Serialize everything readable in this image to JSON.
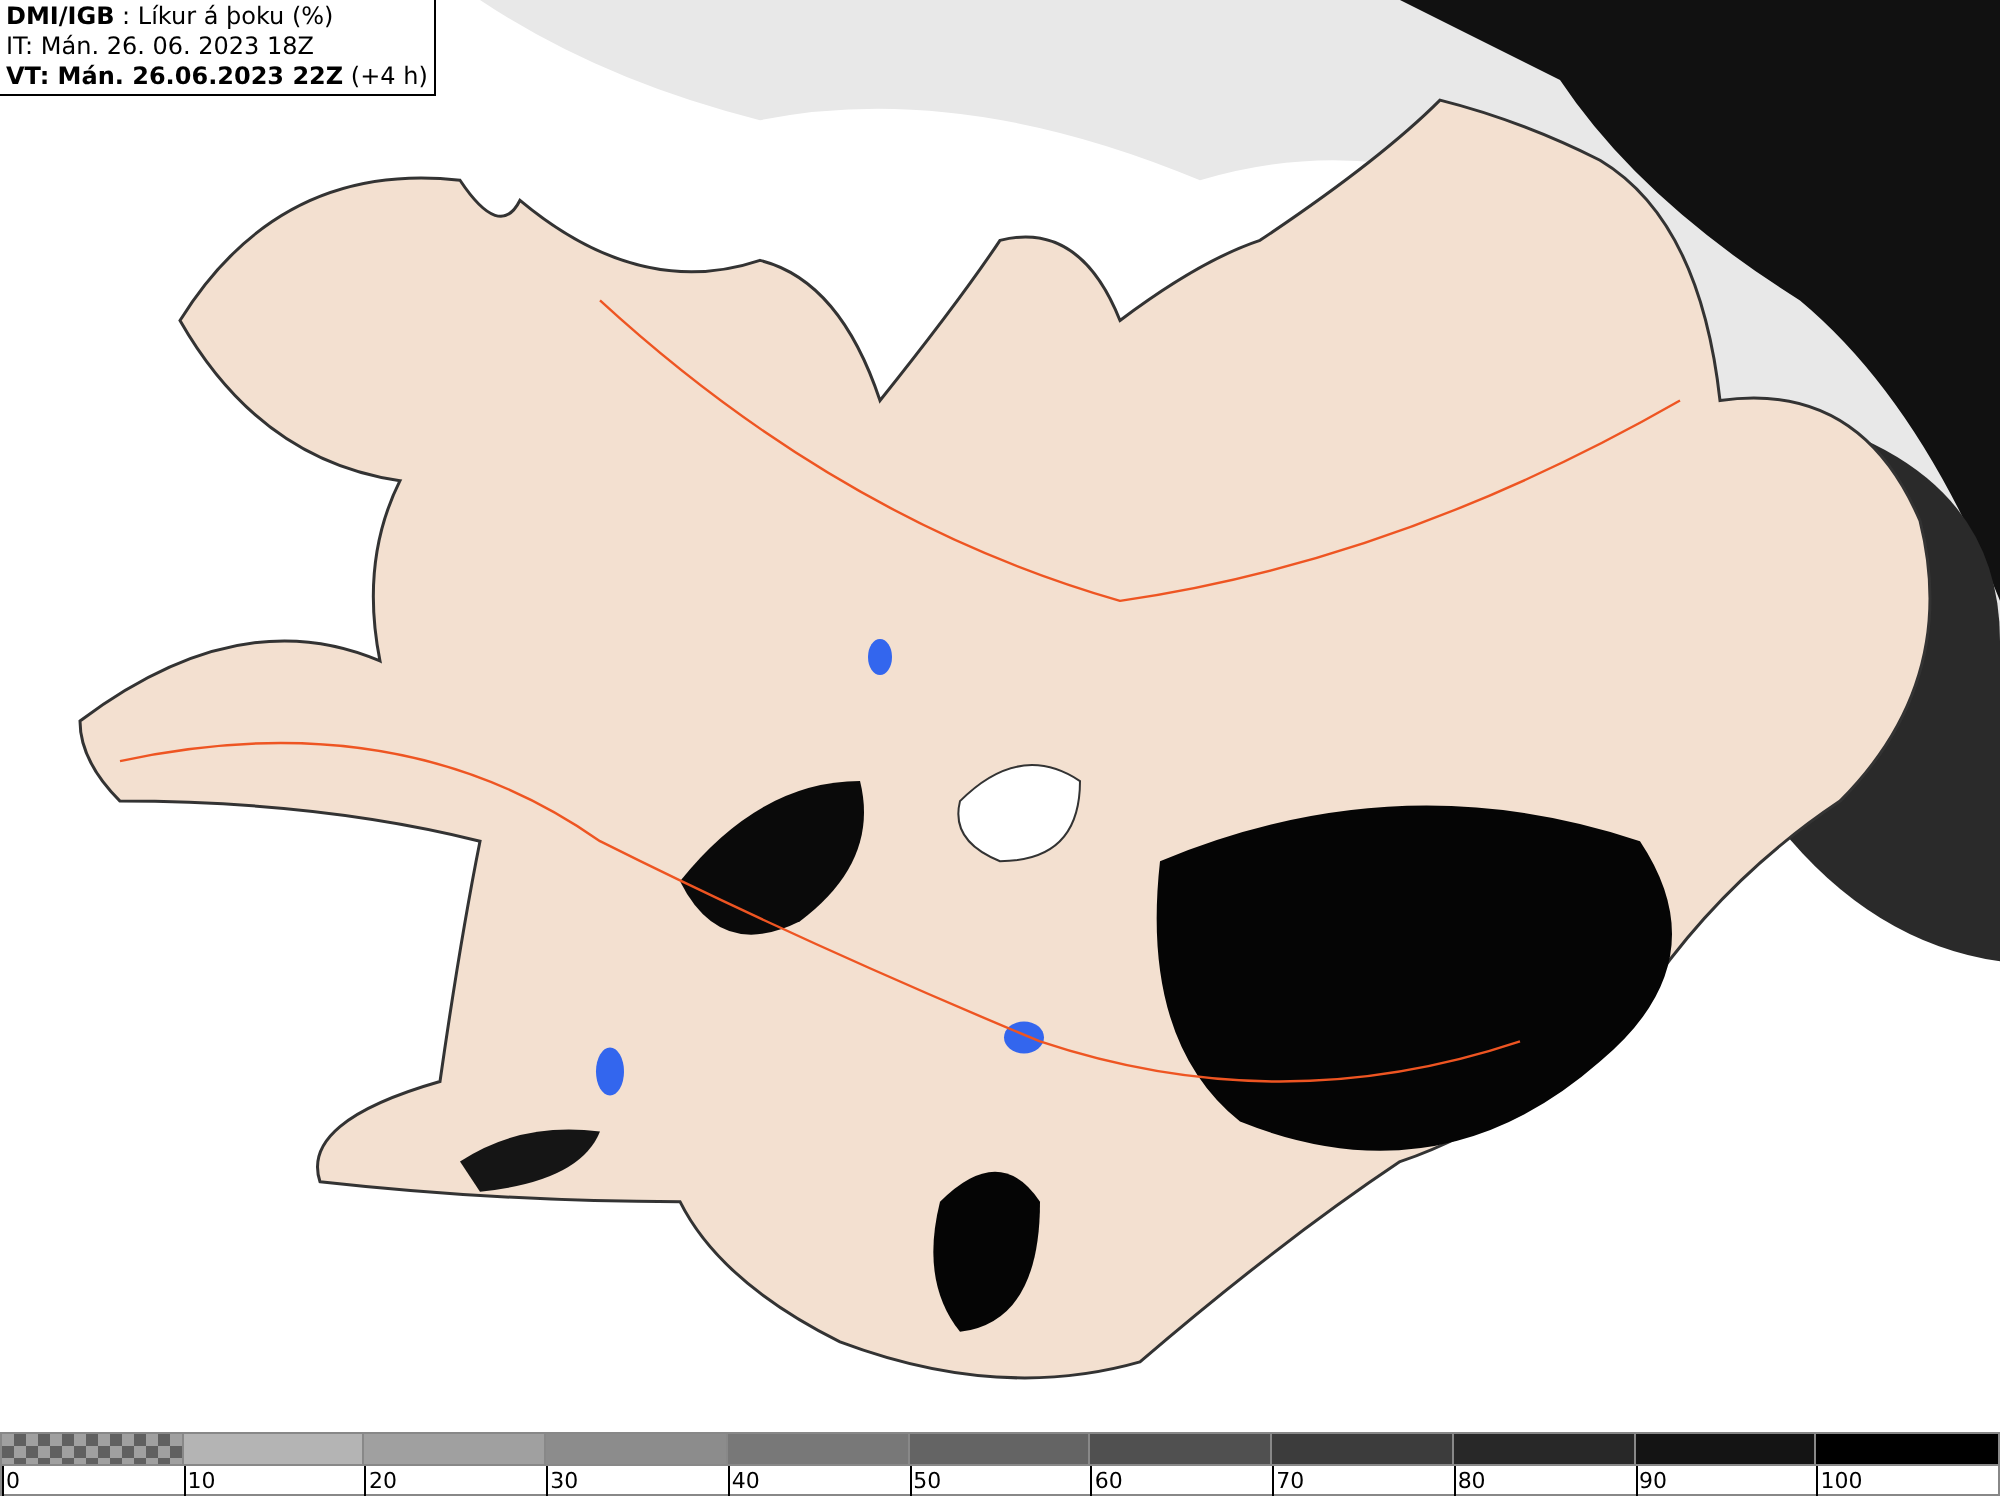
{
  "header": {
    "lines": [
      "**DMI/IGB** : Líkur á þoku (%)",
      "IT: Mán. 26. 06. 2023 18Z",
      "**VT: Mán. 26.06.2023 22Z** (+4 h)"
    ]
  },
  "legend": {
    "segments": [
      {
        "kind": "checker",
        "color": "#606060"
      },
      {
        "kind": "solid",
        "color": "#b4b4b4"
      },
      {
        "kind": "solid",
        "color": "#a0a0a0"
      },
      {
        "kind": "solid",
        "color": "#8c8c8c"
      },
      {
        "kind": "solid",
        "color": "#787878"
      },
      {
        "kind": "solid",
        "color": "#646464"
      },
      {
        "kind": "solid",
        "color": "#505050"
      },
      {
        "kind": "solid",
        "color": "#3c3c3c"
      },
      {
        "kind": "solid",
        "color": "#282828"
      },
      {
        "kind": "solid",
        "color": "#141414"
      },
      {
        "kind": "solid",
        "color": "#000000"
      }
    ],
    "labels": [
      "0",
      "10",
      "20",
      "30",
      "40",
      "50",
      "60",
      "70",
      "80",
      "90",
      "100"
    ]
  }
}
